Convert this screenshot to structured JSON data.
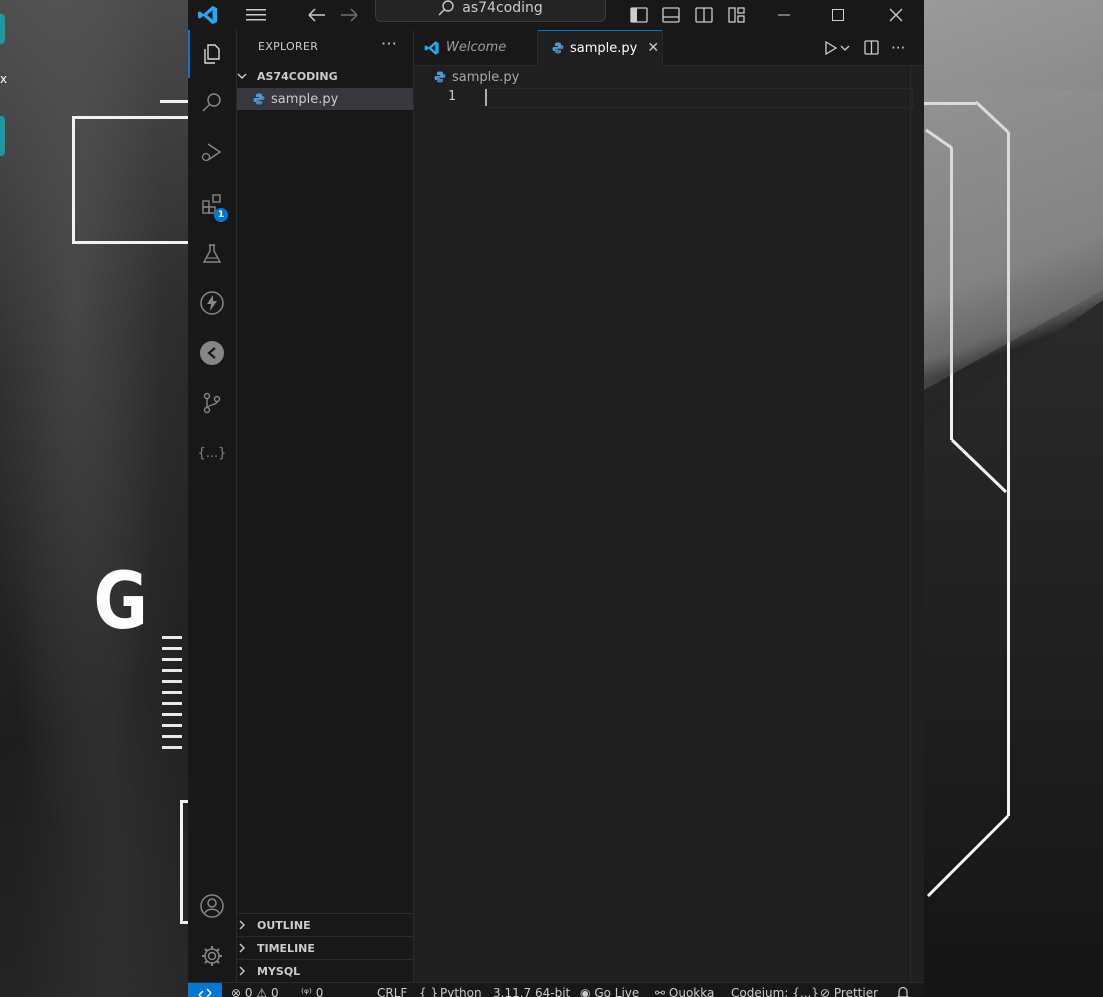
{
  "desktop": {
    "edge_letter_1": "x",
    "logo_letter": "G"
  },
  "titlebar": {
    "search_label": "as74coding"
  },
  "activity_bar": {
    "extensions_badge": "1",
    "json_icon_label": "{...}"
  },
  "sidebar": {
    "title": "EXPLORER",
    "more": "···",
    "folder_name": "AS74CODING",
    "files": [
      {
        "name": "sample.py"
      }
    ],
    "sections": {
      "outline": "OUTLINE",
      "timeline": "TIMELINE",
      "mysql": "MYSQL"
    }
  },
  "editor": {
    "tabs": [
      {
        "label": "Welcome",
        "state": "preview"
      },
      {
        "label": "sample.py",
        "state": "active",
        "close": "✕"
      }
    ],
    "breadcrumb": "sample.py",
    "line_numbers": [
      "1"
    ],
    "more": "···"
  },
  "statusbar": {
    "errors": "0",
    "warnings": "0",
    "ports": "0",
    "eol": "CRLF",
    "braces": "{ }",
    "language": "Python",
    "interpreter": "3.11.7 64-bit",
    "go_live": "Go Live",
    "quokka": "Quokka",
    "codeium": "Codeium: {...}",
    "prettier": "Prettier"
  },
  "colors": {
    "accent": "#0078d4",
    "python_icon": "#4b9cd3",
    "vscode_logo": "#23a9f2"
  }
}
